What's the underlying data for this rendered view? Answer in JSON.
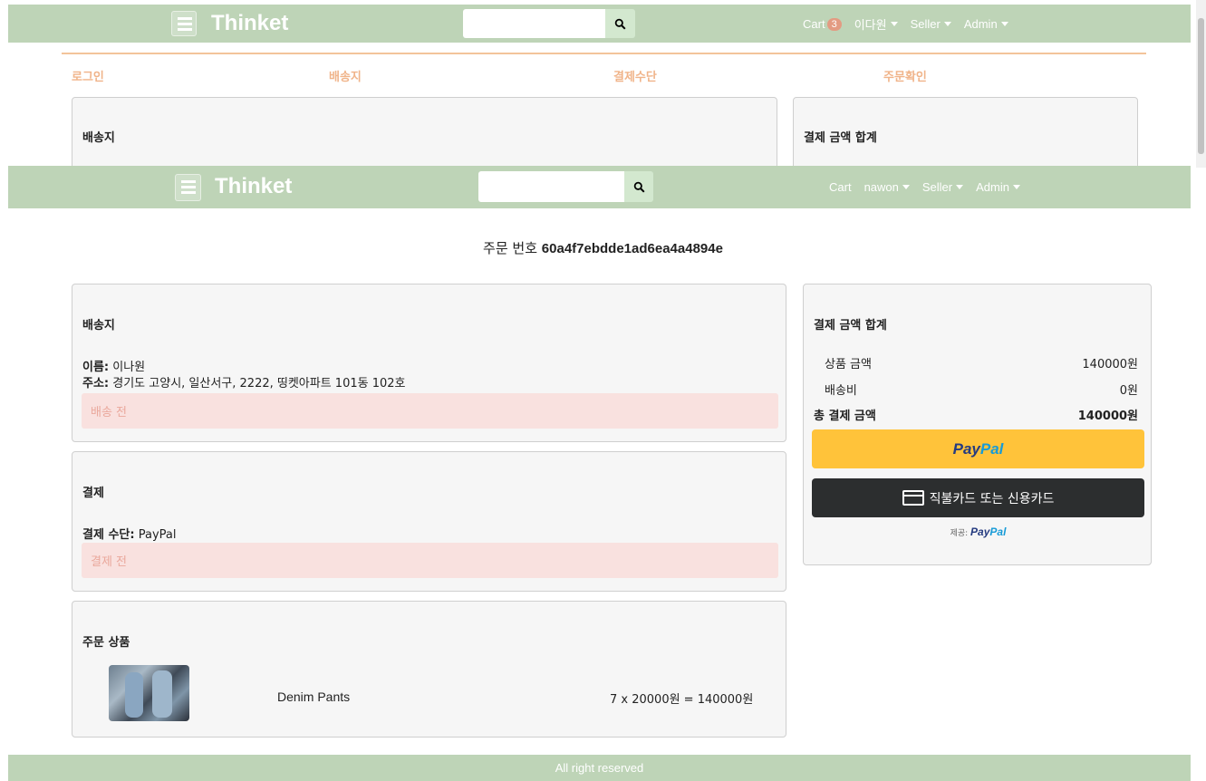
{
  "back_screen": {
    "brand": "Thinket",
    "search": {
      "value": ""
    },
    "nav": {
      "cart": "Cart",
      "cart_count": "3",
      "user": "이다원",
      "seller": "Seller",
      "admin": "Admin"
    },
    "steps": [
      "로그인",
      "배송지",
      "결제수단",
      "주문확인"
    ],
    "shipping_title": "배송지",
    "summary_title": "결제 금액 합계"
  },
  "nav": {
    "brand": "Thinket",
    "search_value": "",
    "cart": "Cart",
    "user": "nawon",
    "seller": "Seller",
    "admin": "Admin"
  },
  "order": {
    "label": "주문 번호",
    "id": "60a4f7ebdde1ad6ea4a4894e"
  },
  "shipping": {
    "title": "배송지",
    "name_label": "이름:",
    "name": "이나원",
    "address_label": "주소:",
    "address": "경기도 고양시, 일산서구, 2222, 띵켓아파트 101동 102호",
    "status": "배송 전"
  },
  "payment": {
    "title": "결제",
    "method_label": "결제 수단:",
    "method": "PayPal",
    "status": "결제 전"
  },
  "items": {
    "title": "주문 상품",
    "list": [
      {
        "name": "Denim Pants",
        "price_line": "7 x 20000원 = 140000원"
      }
    ]
  },
  "summary": {
    "title": "결제 금액 합계",
    "rows": [
      {
        "label": "상품 금액",
        "value": "140000원"
      },
      {
        "label": "배송비",
        "value": "0원"
      },
      {
        "label": "총 결제 금액",
        "value": "140000원"
      }
    ],
    "paypal_pay": "Pay",
    "paypal_pal": "Pal",
    "card_button": "직불카드 또는 신용카드",
    "powered_by": "제공:",
    "powered_pay": "Pay",
    "powered_pal": "Pal"
  },
  "footer": {
    "text": "All right reserved"
  },
  "colors": {
    "nav_bg": "#bed4b7",
    "step_color": "#f0b48a",
    "alert_bg": "#f9e1df",
    "paypal_yellow": "#ffc33a"
  }
}
